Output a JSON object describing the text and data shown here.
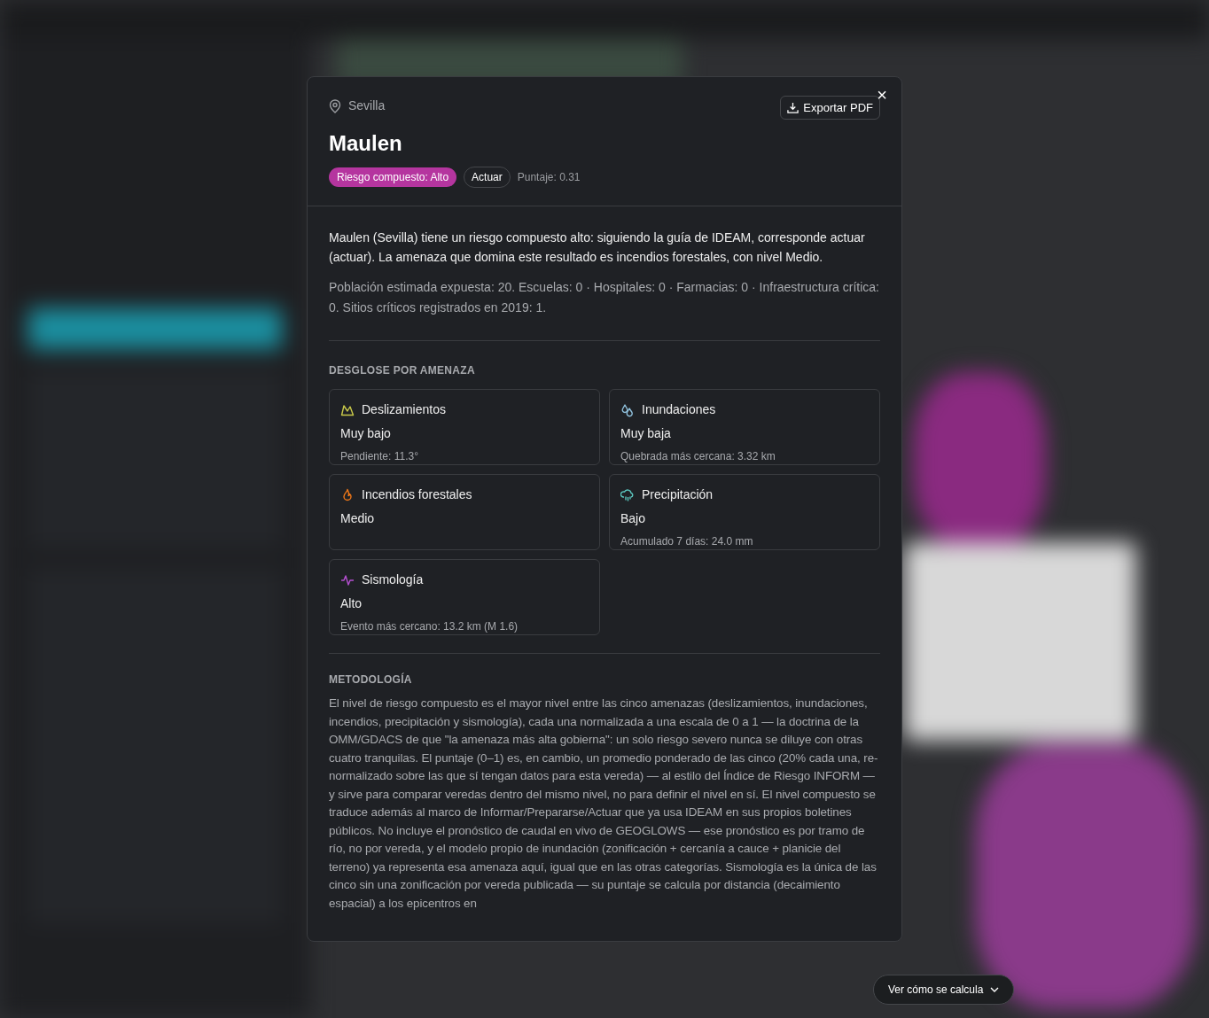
{
  "dialog": {
    "location": "Sevilla",
    "title": "Maulen",
    "risk_badge": "Riesgo compuesto: Alto",
    "action_chip": "Actuar",
    "score": "Puntaje: 0.31",
    "export_button": "Exportar PDF",
    "close_button": "×",
    "summary": "Maulen (Sevilla) tiene un riesgo compuesto alto: siguiendo la guía de IDEAM, corresponde actuar (actuar). La amenaza que domina este resultado es incendios forestales, con nivel Medio.",
    "exposure": "Población estimada expuesta: 20. Escuelas: 0 · Hospitales: 0 · Farmacias: 0 · Infraestructura crítica: 0. Sitios críticos registrados en 2019: 1.",
    "breakdown_heading": "DESGLOSE POR AMENAZA",
    "hazards": [
      {
        "kind": "landslide",
        "color": "#c9c94a",
        "name": "Deslizamientos",
        "level": "Muy bajo",
        "detail": "Pendiente: 11.3°"
      },
      {
        "kind": "flood",
        "color": "#8fc0dc",
        "name": "Inundaciones",
        "level": "Muy baja",
        "detail": "Quebrada más cercana: 3.32 km"
      },
      {
        "kind": "fire",
        "color": "#f07818",
        "name": "Incendios forestales",
        "level": "Medio"
      },
      {
        "kind": "rain",
        "color": "#5cc8c0",
        "name": "Precipitación",
        "level": "Bajo",
        "detail": "Acumulado 7 días: 24.0 mm"
      },
      {
        "kind": "seismic",
        "color": "#b44fd0",
        "name": "Sismología",
        "level": "Alto",
        "detail": "Evento más cercano: 13.2 km (M 1.6)"
      }
    ],
    "methodology_heading": "METODOLOGÍA",
    "methodology": "El nivel de riesgo compuesto es el mayor nivel entre las cinco amenazas (deslizamientos, inundaciones, incendios, precipitación y sismología), cada una normalizada a una escala de 0 a 1 — la doctrina de la OMM/GDACS de que \"la amenaza más alta gobierna\": un solo riesgo severo nunca se diluye con otras cuatro tranquilas. El puntaje (0–1) es, en cambio, un promedio ponderado de las cinco (20% cada una, re-normalizado sobre las que sí tengan datos para esta vereda) — al estilo del Índice de Riesgo INFORM — y sirve para comparar veredas dentro del mismo nivel, no para definir el nivel en sí. El nivel compuesto se traduce además al marco de Informar/Prepararse/Actuar que ya usa IDEAM en sus propios boletines públicos. No incluye el pronóstico de caudal en vivo de GEOGLOWS — ese pronóstico es por tramo de río, no por vereda, y el modelo propio de inundación (zonificación + cercanía a cauce + planicie del terreno) ya representa esa amenaza aquí, igual que en las otras categorías. Sismología es la única de las cinco sin una zonificación por vereda publicada — su puntaje se calcula por distancia (decaimiento espacial) a los epicentros en"
  },
  "calc_button": "Ver cómo se calcula"
}
